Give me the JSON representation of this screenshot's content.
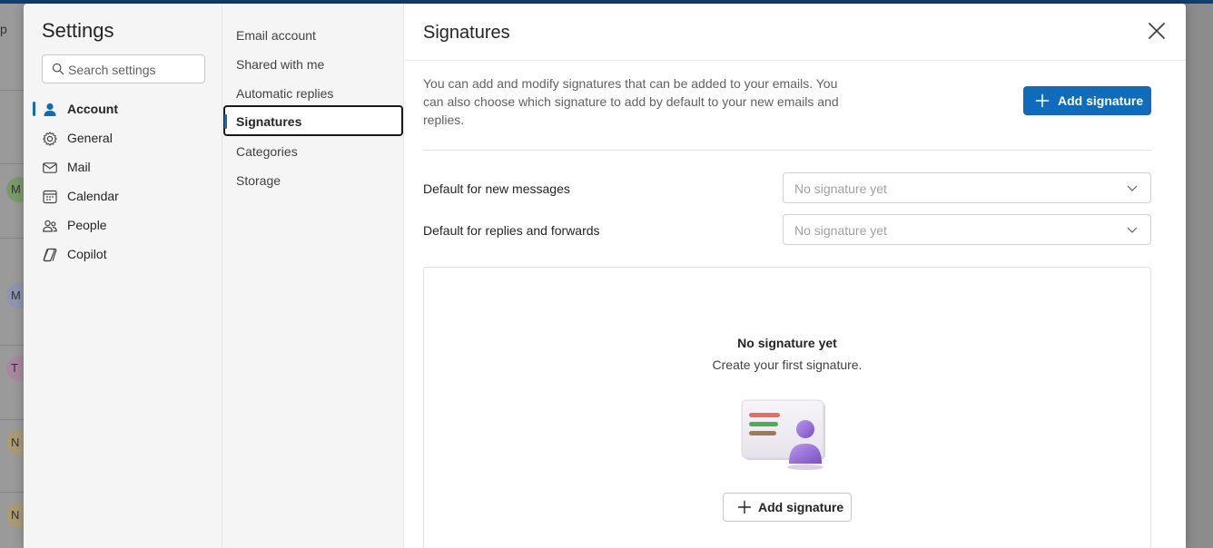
{
  "background_app": {
    "partial_label": "p",
    "avatars": [
      "M",
      "M",
      "T",
      "N",
      "N"
    ]
  },
  "settings": {
    "title": "Settings",
    "search": {
      "placeholder": "Search settings"
    },
    "categories": [
      {
        "label": "Account",
        "icon": "person-icon",
        "active": true
      },
      {
        "label": "General",
        "icon": "gear-icon"
      },
      {
        "label": "Mail",
        "icon": "mail-icon"
      },
      {
        "label": "Calendar",
        "icon": "calendar-icon"
      },
      {
        "label": "People",
        "icon": "people-icon"
      },
      {
        "label": "Copilot",
        "icon": "copilot-icon"
      }
    ]
  },
  "account_nav": {
    "items": [
      {
        "label": "Email account"
      },
      {
        "label": "Shared with me"
      },
      {
        "label": "Automatic replies"
      },
      {
        "label": "Signatures",
        "active": true
      },
      {
        "label": "Categories"
      },
      {
        "label": "Storage"
      }
    ]
  },
  "signatures": {
    "title": "Signatures",
    "description": "You can add and modify signatures that can be added to your emails. You can also choose which signature to add by default to your new emails and replies.",
    "add_button_label": "Add signature",
    "default_new": {
      "label": "Default for new messages",
      "value": "No signature yet"
    },
    "default_replies": {
      "label": "Default for replies and forwards",
      "value": "No signature yet"
    },
    "empty_state": {
      "title": "No signature yet",
      "subtitle": "Create your first signature.",
      "button_label": "Add signature"
    }
  },
  "colors": {
    "accent": "#0f6cbd",
    "nav_background": "#f5f5f5"
  }
}
